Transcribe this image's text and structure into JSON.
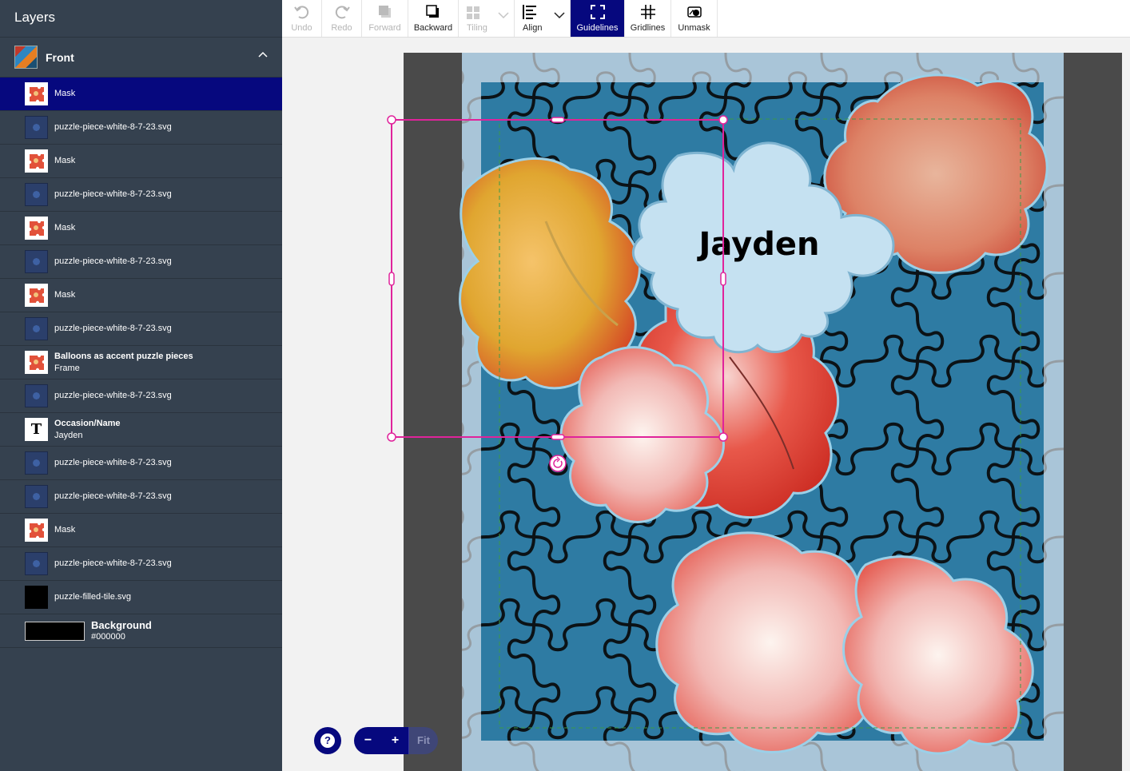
{
  "sidebar": {
    "title": "Layers",
    "group": {
      "label": "Front"
    },
    "layers": [
      {
        "label": "Mask",
        "sub": "",
        "kind": "mask",
        "selected": true
      },
      {
        "label": "puzzle-piece-white-8-7-23.svg",
        "sub": "",
        "kind": "svg"
      },
      {
        "label": "Mask",
        "sub": "",
        "kind": "mask"
      },
      {
        "label": "puzzle-piece-white-8-7-23.svg",
        "sub": "",
        "kind": "svg"
      },
      {
        "label": "Mask",
        "sub": "",
        "kind": "mask"
      },
      {
        "label": "puzzle-piece-white-8-7-23.svg",
        "sub": "",
        "kind": "svg"
      },
      {
        "label": "Mask",
        "sub": "",
        "kind": "mask"
      },
      {
        "label": "puzzle-piece-white-8-7-23.svg",
        "sub": "",
        "kind": "svg"
      },
      {
        "label": "Balloons as accent puzzle pieces",
        "sub": "Frame",
        "kind": "frame"
      },
      {
        "label": "puzzle-piece-white-8-7-23.svg",
        "sub": "",
        "kind": "svg"
      },
      {
        "label": "Occasion/Name",
        "sub": "Jayden",
        "kind": "text"
      },
      {
        "label": "puzzle-piece-white-8-7-23.svg",
        "sub": "",
        "kind": "svg"
      },
      {
        "label": "puzzle-piece-white-8-7-23.svg",
        "sub": "",
        "kind": "svg"
      },
      {
        "label": "Mask",
        "sub": "",
        "kind": "mask"
      },
      {
        "label": "puzzle-piece-white-8-7-23.svg",
        "sub": "",
        "kind": "svg"
      },
      {
        "label": "puzzle-filled-tile.svg",
        "sub": "",
        "kind": "tile"
      },
      {
        "label": "Background",
        "sub": "#000000",
        "kind": "bg"
      }
    ],
    "text_thumb_glyph": "T"
  },
  "toolbar": {
    "undo": "Undo",
    "redo": "Redo",
    "forward": "Forward",
    "backward": "Backward",
    "tiling": "Tiling",
    "align": "Align",
    "guidelines": "Guidelines",
    "gridlines": "Gridlines",
    "unmask": "Unmask"
  },
  "canvas": {
    "name_text": "Jayden"
  },
  "zoom": {
    "help": "?",
    "out": "−",
    "in": "+",
    "fit": "Fit"
  },
  "colors": {
    "selection": "#e0239b",
    "accent": "#06087e",
    "puzzle_blue": "#2e7ba3",
    "puzzle_light": "#a9c8dc"
  }
}
